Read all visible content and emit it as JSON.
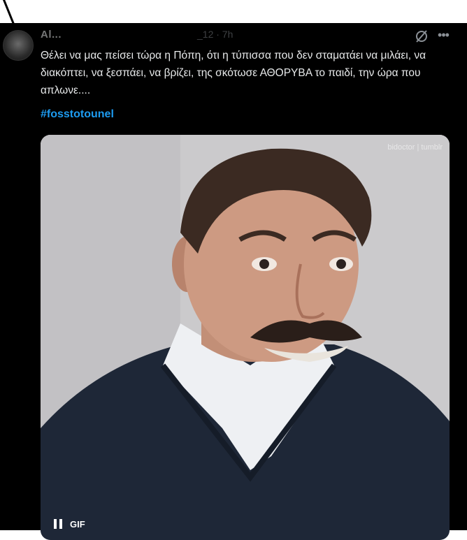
{
  "tweet": {
    "author_name": "Al...",
    "meta": "_12 · 7h",
    "text": "Θέλει να μας πείσει τώρα η Πόπη, ότι η τύπισσα που δεν σταματάει να μιλάει, να διακόπτει, να ξεσπάει, να βρίζει, της σκότωσε ΑΘΟΡΥΒΑ το παιδί, την ώρα που απλωνε....",
    "hashtag": "#fosstotounel",
    "media": {
      "watermark": "bidoctor | tumblr",
      "gif_label": "GIF"
    }
  },
  "icons": {
    "avatar": "user-avatar",
    "grok": "slashed-circle-icon",
    "more": "more-dots-icon",
    "pause": "pause-icon"
  },
  "colors": {
    "background": "#000000",
    "text": "#e7e9ea",
    "hashtag": "#1d9bf0",
    "muted": "#71767b"
  }
}
